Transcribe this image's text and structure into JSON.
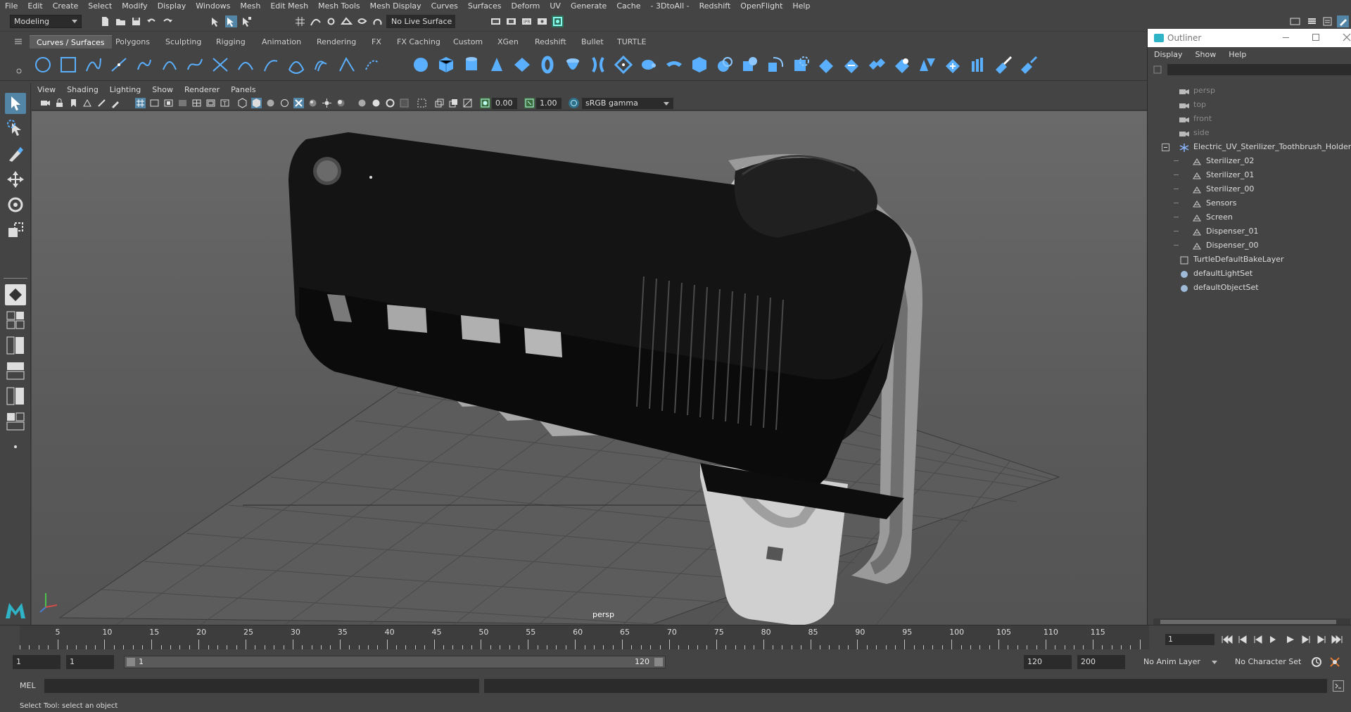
{
  "menubar": {
    "items": [
      "File",
      "Edit",
      "Create",
      "Select",
      "Modify",
      "Display",
      "Windows",
      "Mesh",
      "Edit Mesh",
      "Mesh Tools",
      "Mesh Display",
      "Curves",
      "Surfaces",
      "Deform",
      "UV",
      "Generate",
      "Cache",
      "- 3DtoAll -",
      "Redshift",
      "OpenFlight",
      "Help"
    ]
  },
  "statusline": {
    "mode": "Modeling",
    "live_surface": "No Live Surface"
  },
  "shelf": {
    "tabs": [
      "Curves / Surfaces",
      "Polygons",
      "Sculpting",
      "Rigging",
      "Animation",
      "Rendering",
      "FX",
      "FX Caching",
      "Custom",
      "XGen",
      "Redshift",
      "Bullet",
      "TURTLE"
    ],
    "active_tab": "Curves / Surfaces"
  },
  "viewport": {
    "menus": [
      "View",
      "Shading",
      "Lighting",
      "Show",
      "Renderer",
      "Panels"
    ],
    "exposure": "0.00",
    "gamma": "1.00",
    "color_space": "sRGB gamma",
    "camera_label": "persp"
  },
  "outliner": {
    "title": "Outliner",
    "menus": [
      "Display",
      "Show",
      "Help"
    ],
    "cameras": [
      "persp",
      "top",
      "front",
      "side"
    ],
    "root": "Electric_UV_Sterilizer_Toothbrush_Holder_Bl",
    "children": [
      "Sterilizer_02",
      "Sterilizer_01",
      "Sterilizer_00",
      "Sensors",
      "Screen",
      "Dispenser_01",
      "Dispenser_00"
    ],
    "sets": [
      "TurtleDefaultBakeLayer",
      "defaultLightSet",
      "defaultObjectSet"
    ]
  },
  "timeline": {
    "ticks": [
      "5",
      "10",
      "15",
      "20",
      "25",
      "30",
      "35",
      "40",
      "45",
      "50",
      "55",
      "60",
      "65",
      "70",
      "75",
      "80",
      "85",
      "90",
      "95",
      "100",
      "105",
      "110",
      "115"
    ],
    "start_marker": "1",
    "current_frame": "1"
  },
  "range": {
    "start": "1",
    "anim_start": "1",
    "slider_start": "1",
    "slider_end": "120",
    "anim_end": "120",
    "end": "200",
    "anim_layer": "No Anim Layer",
    "character_set": "No Character Set"
  },
  "cmdline": {
    "label": "MEL"
  },
  "helpline": {
    "text": "Select Tool: select an object"
  }
}
